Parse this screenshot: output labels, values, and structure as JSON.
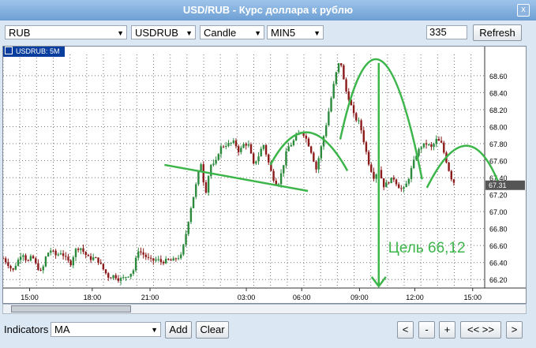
{
  "window": {
    "title": "USD/RUB - Курс доллара к рублю",
    "close_label": "x"
  },
  "toolbar": {
    "currency": "RUB",
    "symbol": "USDRUB",
    "chart_type": "Candle",
    "interval": "MIN5",
    "count_value": "335",
    "refresh_label": "Refresh"
  },
  "chart_label": "USDRUB: 5M",
  "annotation": {
    "target_text": "Цель 66,12"
  },
  "bottom": {
    "indicators_label": "Indicators",
    "indicator_value": "MA",
    "add_label": "Add",
    "clear_label": "Clear",
    "nav": [
      "<",
      "-",
      "+",
      "<< >>",
      ">"
    ]
  },
  "colors": {
    "up": "#2c8a3c",
    "down": "#8b1a1a",
    "annotation": "#3cb54a",
    "grid": "#777777"
  },
  "chart_data": {
    "type": "candlestick",
    "symbol": "USDRUB",
    "interval": "5M",
    "x_tick_labels": [
      "15:00",
      "18:00",
      "21:00",
      "03:00",
      "06:00",
      "09:00",
      "12:00",
      "15:00"
    ],
    "y_ticks": [
      66.2,
      66.4,
      66.6,
      66.8,
      67.0,
      67.2,
      67.4,
      67.6,
      67.8,
      68.0,
      68.2,
      68.4,
      68.6
    ],
    "y_tick_labels": [
      "66.20",
      "66.40",
      "66.60",
      "66.80",
      "67.00",
      "67.20",
      "67.40",
      "67.60",
      "67.80",
      "68.00",
      "68.20",
      "68.40",
      "68.60"
    ],
    "ylim": [
      66.1,
      68.85
    ],
    "last_price": 67.31,
    "last_price_label": "67.31",
    "grid": true,
    "annotations": {
      "pattern": "head-and-shoulders",
      "neckline": [
        [
          0.335,
          67.55
        ],
        [
          0.633,
          67.28
        ]
      ],
      "target": 66.12
    },
    "series_close": [
      [
        0.0,
        66.45
      ],
      [
        0.01,
        66.38
      ],
      [
        0.02,
        66.3
      ],
      [
        0.03,
        66.42
      ],
      [
        0.04,
        66.52
      ],
      [
        0.05,
        66.4
      ],
      [
        0.06,
        66.48
      ],
      [
        0.07,
        66.35
      ],
      [
        0.08,
        66.28
      ],
      [
        0.09,
        66.5
      ],
      [
        0.1,
        66.55
      ],
      [
        0.11,
        66.48
      ],
      [
        0.12,
        66.52
      ],
      [
        0.13,
        66.45
      ],
      [
        0.14,
        66.38
      ],
      [
        0.15,
        66.55
      ],
      [
        0.16,
        66.58
      ],
      [
        0.17,
        66.5
      ],
      [
        0.18,
        66.44
      ],
      [
        0.19,
        66.46
      ],
      [
        0.2,
        66.4
      ],
      [
        0.21,
        66.3
      ],
      [
        0.22,
        66.22
      ],
      [
        0.23,
        66.25
      ],
      [
        0.24,
        66.2
      ],
      [
        0.25,
        66.22
      ],
      [
        0.26,
        66.25
      ],
      [
        0.27,
        66.3
      ],
      [
        0.28,
        66.55
      ],
      [
        0.29,
        66.5
      ],
      [
        0.3,
        66.45
      ],
      [
        0.31,
        66.42
      ],
      [
        0.32,
        66.44
      ],
      [
        0.33,
        66.4
      ],
      [
        0.34,
        66.43
      ],
      [
        0.35,
        66.42
      ],
      [
        0.36,
        66.45
      ],
      [
        0.37,
        66.48
      ],
      [
        0.38,
        66.75
      ],
      [
        0.39,
        67.05
      ],
      [
        0.4,
        67.3
      ],
      [
        0.41,
        67.6
      ],
      [
        0.42,
        67.2
      ],
      [
        0.43,
        67.55
      ],
      [
        0.44,
        67.55
      ],
      [
        0.45,
        67.75
      ],
      [
        0.46,
        67.78
      ],
      [
        0.47,
        67.8
      ],
      [
        0.48,
        67.82
      ],
      [
        0.49,
        67.7
      ],
      [
        0.5,
        67.8
      ],
      [
        0.51,
        67.78
      ],
      [
        0.52,
        67.55
      ],
      [
        0.53,
        67.65
      ],
      [
        0.54,
        67.8
      ],
      [
        0.55,
        67.6
      ],
      [
        0.56,
        67.4
      ],
      [
        0.57,
        67.3
      ],
      [
        0.58,
        67.5
      ],
      [
        0.59,
        67.75
      ],
      [
        0.6,
        67.8
      ],
      [
        0.61,
        67.9
      ],
      [
        0.62,
        67.95
      ],
      [
        0.63,
        67.85
      ],
      [
        0.64,
        67.7
      ],
      [
        0.65,
        67.5
      ],
      [
        0.66,
        67.75
      ],
      [
        0.67,
        68.0
      ],
      [
        0.68,
        68.3
      ],
      [
        0.69,
        68.6
      ],
      [
        0.7,
        68.8
      ],
      [
        0.71,
        68.45
      ],
      [
        0.72,
        68.3
      ],
      [
        0.73,
        68.1
      ],
      [
        0.74,
        68.05
      ],
      [
        0.75,
        67.8
      ],
      [
        0.76,
        67.55
      ],
      [
        0.77,
        67.4
      ],
      [
        0.78,
        67.5
      ],
      [
        0.79,
        67.3
      ],
      [
        0.8,
        67.35
      ],
      [
        0.81,
        67.4
      ],
      [
        0.82,
        67.3
      ],
      [
        0.83,
        67.25
      ],
      [
        0.84,
        67.35
      ],
      [
        0.85,
        67.55
      ],
      [
        0.86,
        67.7
      ],
      [
        0.87,
        67.78
      ],
      [
        0.88,
        67.8
      ],
      [
        0.89,
        67.75
      ],
      [
        0.9,
        67.85
      ],
      [
        0.91,
        67.8
      ],
      [
        0.92,
        67.6
      ],
      [
        0.93,
        67.4
      ],
      [
        0.94,
        67.31
      ]
    ]
  }
}
